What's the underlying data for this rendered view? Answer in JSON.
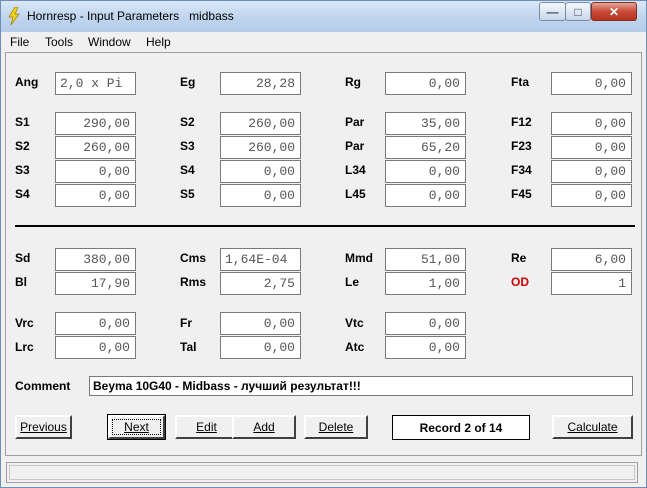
{
  "window": {
    "title": "Hornresp - Input Parameters   midbass"
  },
  "menu": [
    "File",
    "Tools",
    "Window",
    "Help"
  ],
  "horn": {
    "row1": [
      {
        "label": "Ang",
        "value": "2,0 x Pi"
      },
      {
        "label": "Eg",
        "value": "28,28"
      },
      {
        "label": "Rg",
        "value": "0,00"
      },
      {
        "label": "Fta",
        "value": "0,00"
      }
    ],
    "col1": [
      {
        "label": "S1",
        "value": "290,00"
      },
      {
        "label": "S2",
        "value": "260,00"
      },
      {
        "label": "S3",
        "value": "0,00"
      },
      {
        "label": "S4",
        "value": "0,00"
      }
    ],
    "col2": [
      {
        "label": "S2",
        "value": "260,00"
      },
      {
        "label": "S3",
        "value": "260,00"
      },
      {
        "label": "S4",
        "value": "0,00"
      },
      {
        "label": "S5",
        "value": "0,00"
      }
    ],
    "col3": [
      {
        "label": "Par",
        "value": "35,00"
      },
      {
        "label": "Par",
        "value": "65,20"
      },
      {
        "label": "L34",
        "value": "0,00"
      },
      {
        "label": "L45",
        "value": "0,00"
      }
    ],
    "col4": [
      {
        "label": "F12",
        "value": "0,00"
      },
      {
        "label": "F23",
        "value": "0,00"
      },
      {
        "label": "F34",
        "value": "0,00"
      },
      {
        "label": "F45",
        "value": "0,00"
      }
    ]
  },
  "driver": {
    "row1": [
      {
        "label": "Sd",
        "value": "380,00"
      },
      {
        "label": "Cms",
        "value": "1,64E-04"
      },
      {
        "label": "Mmd",
        "value": "51,00"
      },
      {
        "label": "Re",
        "value": "6,00"
      }
    ],
    "row2": [
      {
        "label": "Bl",
        "value": "17,90"
      },
      {
        "label": "Rms",
        "value": "2,75"
      },
      {
        "label": "Le",
        "value": "1,00"
      },
      {
        "label": "OD",
        "value": "1"
      }
    ]
  },
  "chamber": {
    "row1": [
      {
        "label": "Vrc",
        "value": "0,00"
      },
      {
        "label": "Fr",
        "value": "0,00"
      },
      {
        "label": "Vtc",
        "value": "0,00"
      }
    ],
    "row2": [
      {
        "label": "Lrc",
        "value": "0,00"
      },
      {
        "label": "Tal",
        "value": "0,00"
      },
      {
        "label": "Atc",
        "value": "0,00"
      }
    ]
  },
  "comment": {
    "label": "Comment",
    "value": "Beyma 10G40 - Midbass - лучший результат!!!"
  },
  "buttons": {
    "previous": "Previous",
    "next": "Next",
    "edit": "Edit",
    "add": "Add",
    "delete": "Delete",
    "calculate": "Calculate"
  },
  "record": "Record 2 of 14",
  "colors": {
    "od_label": "#cc0000"
  }
}
